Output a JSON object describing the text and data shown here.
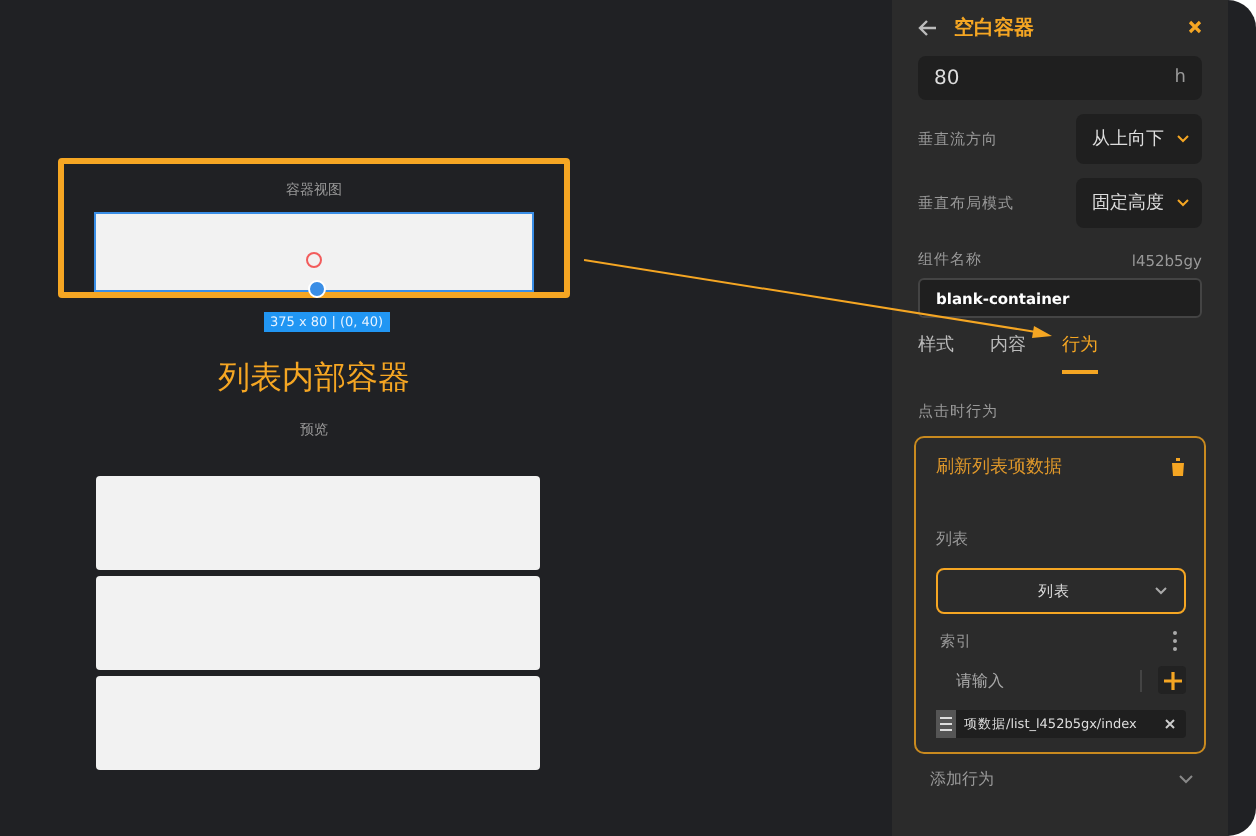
{
  "canvas": {
    "container_label": "容器视图",
    "size_badge": "375 x 80 | (0, 40)",
    "caption": "列表内部容器",
    "preview_label": "预览",
    "preview_rows": [
      {
        "kind": "row"
      },
      {
        "kind": "row"
      },
      {
        "kind": "row"
      }
    ]
  },
  "panel": {
    "title": "空白容器",
    "height_field": {
      "value": "80",
      "unit": "h"
    },
    "selects": [
      {
        "label": "垂直流方向",
        "value": "从上向下"
      },
      {
        "label": "垂直布局模式",
        "value": "固定高度"
      }
    ],
    "name_label": "组件名称",
    "component_id": "l452b5gy",
    "name_field": {
      "value": "blank-container"
    },
    "tabs": [
      {
        "label": "样式",
        "selected": false
      },
      {
        "label": "内容",
        "selected": false
      },
      {
        "label": "行为",
        "selected": true
      }
    ],
    "trigger_label": "点击时行为",
    "action": {
      "title": "刷新列表项数据",
      "list_label": "列表",
      "list_select": "列表",
      "index_label": "索引",
      "index_field": {
        "placeholder": "请输入"
      },
      "tags": [
        "项数据/list_l452b5gx/index"
      ]
    },
    "add_action": "添加行为"
  }
}
